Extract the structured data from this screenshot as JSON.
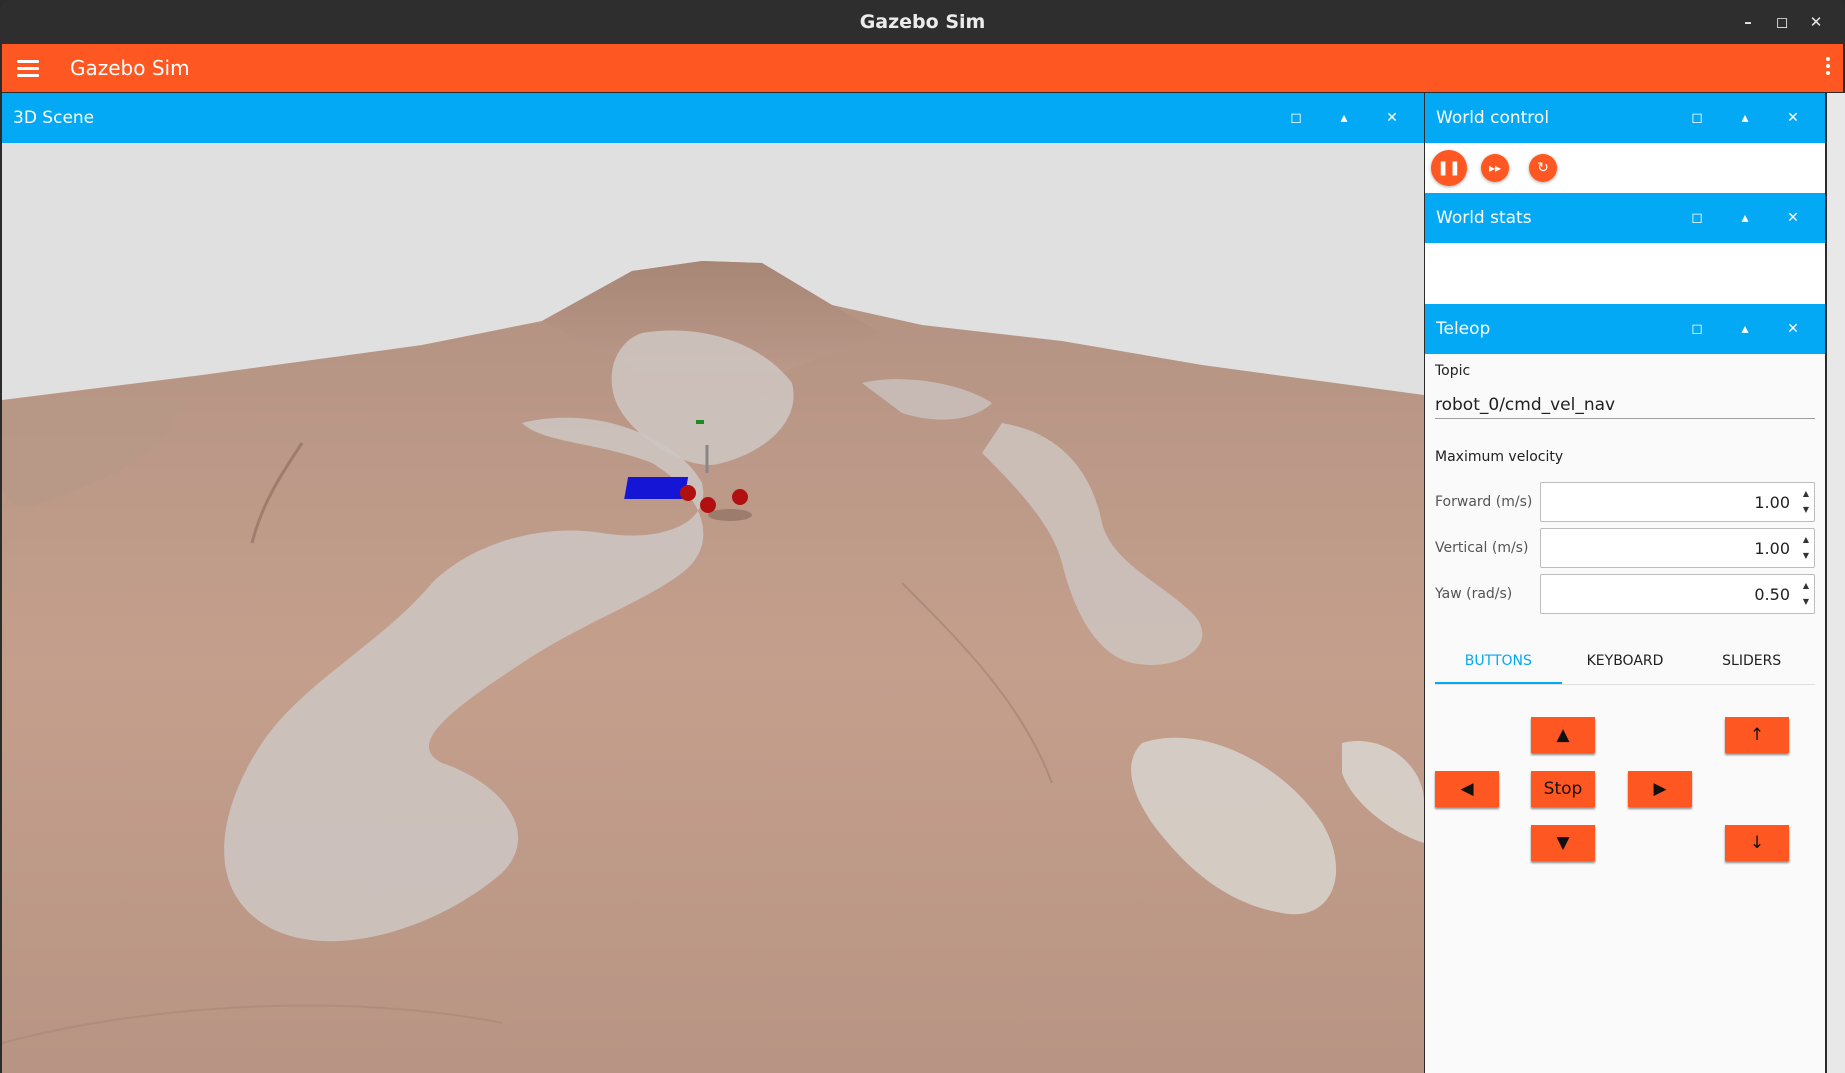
{
  "window": {
    "title": "Gazebo Sim",
    "minimize_icon": "–",
    "maximize_icon": "◻",
    "close_icon": "✕"
  },
  "appbar": {
    "title": "Gazebo Sim",
    "menu_icon": "hamburger-icon",
    "overflow_icon": "kebab-icon"
  },
  "panel_buttons": {
    "maximize": "◻",
    "collapse": "▴",
    "close": "✕"
  },
  "scene": {
    "title": "3D Scene"
  },
  "world_control": {
    "title": "World control",
    "pause_icon": "❚❚",
    "step_icon": "▸▸",
    "reset_icon": "↻"
  },
  "world_stats": {
    "title": "World stats"
  },
  "teleop": {
    "title": "Teleop",
    "topic_label": "Topic",
    "topic_value": "robot_0/cmd_vel_nav",
    "max_velocity_label": "Maximum velocity",
    "forward_label": "Forward (m/s)",
    "forward_value": "1.00",
    "vertical_label": "Vertical (m/s)",
    "vertical_value": "1.00",
    "yaw_label": "Yaw (rad/s)",
    "yaw_value": "0.50",
    "tabs": [
      "BUTTONS",
      "KEYBOARD",
      "SLIDERS"
    ],
    "active_tab": "BUTTONS",
    "buttons": {
      "forward": "▲",
      "backward": "▼",
      "left": "◀",
      "right": "▶",
      "stop": "Stop",
      "up": "↑",
      "down": "↓"
    }
  },
  "colors": {
    "appbar": "#ff5722",
    "panel_header": "#03a9f4",
    "accent_button": "#ff5722"
  }
}
